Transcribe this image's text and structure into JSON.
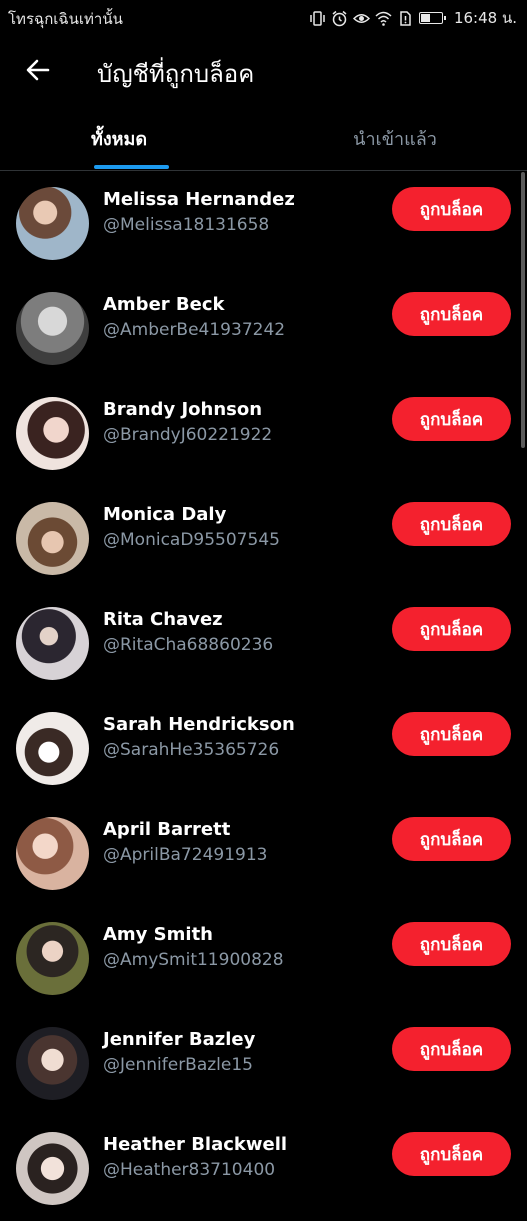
{
  "status_bar": {
    "left_text": "โทรฉุกเฉินเท่านั้น",
    "time": "16:48 น."
  },
  "header": {
    "title": "บัญชีที่ถูกบล็อค"
  },
  "tabs": [
    {
      "label": "ทั้งหมด",
      "active": true
    },
    {
      "label": "นำเข้าแล้ว",
      "active": false
    }
  ],
  "accent_color": "#1d9bf0",
  "button_color": "#f4212e",
  "accounts": [
    {
      "name": "Melissa Hernandez",
      "handle": "@Melissa18131658",
      "button": "ถูกบล็อค"
    },
    {
      "name": "Amber Beck",
      "handle": "@AmberBe41937242",
      "button": "ถูกบล็อค"
    },
    {
      "name": "Brandy Johnson",
      "handle": "@BrandyJ60221922",
      "button": "ถูกบล็อค"
    },
    {
      "name": "Monica Daly",
      "handle": "@MonicaD95507545",
      "button": "ถูกบล็อค"
    },
    {
      "name": "Rita Chavez",
      "handle": "@RitaCha68860236",
      "button": "ถูกบล็อค"
    },
    {
      "name": "Sarah Hendrickson",
      "handle": "@SarahHe35365726",
      "button": "ถูกบล็อค"
    },
    {
      "name": "April Barrett",
      "handle": "@AprilBa72491913",
      "button": "ถูกบล็อค"
    },
    {
      "name": "Amy Smith",
      "handle": "@AmySmit11900828",
      "button": "ถูกบล็อค"
    },
    {
      "name": "Jennifer Bazley",
      "handle": "@JenniferBazle15",
      "button": "ถูกบล็อค"
    },
    {
      "name": "Heather Blackwell",
      "handle": "@Heather83710400",
      "button": "ถูกบล็อค"
    }
  ]
}
